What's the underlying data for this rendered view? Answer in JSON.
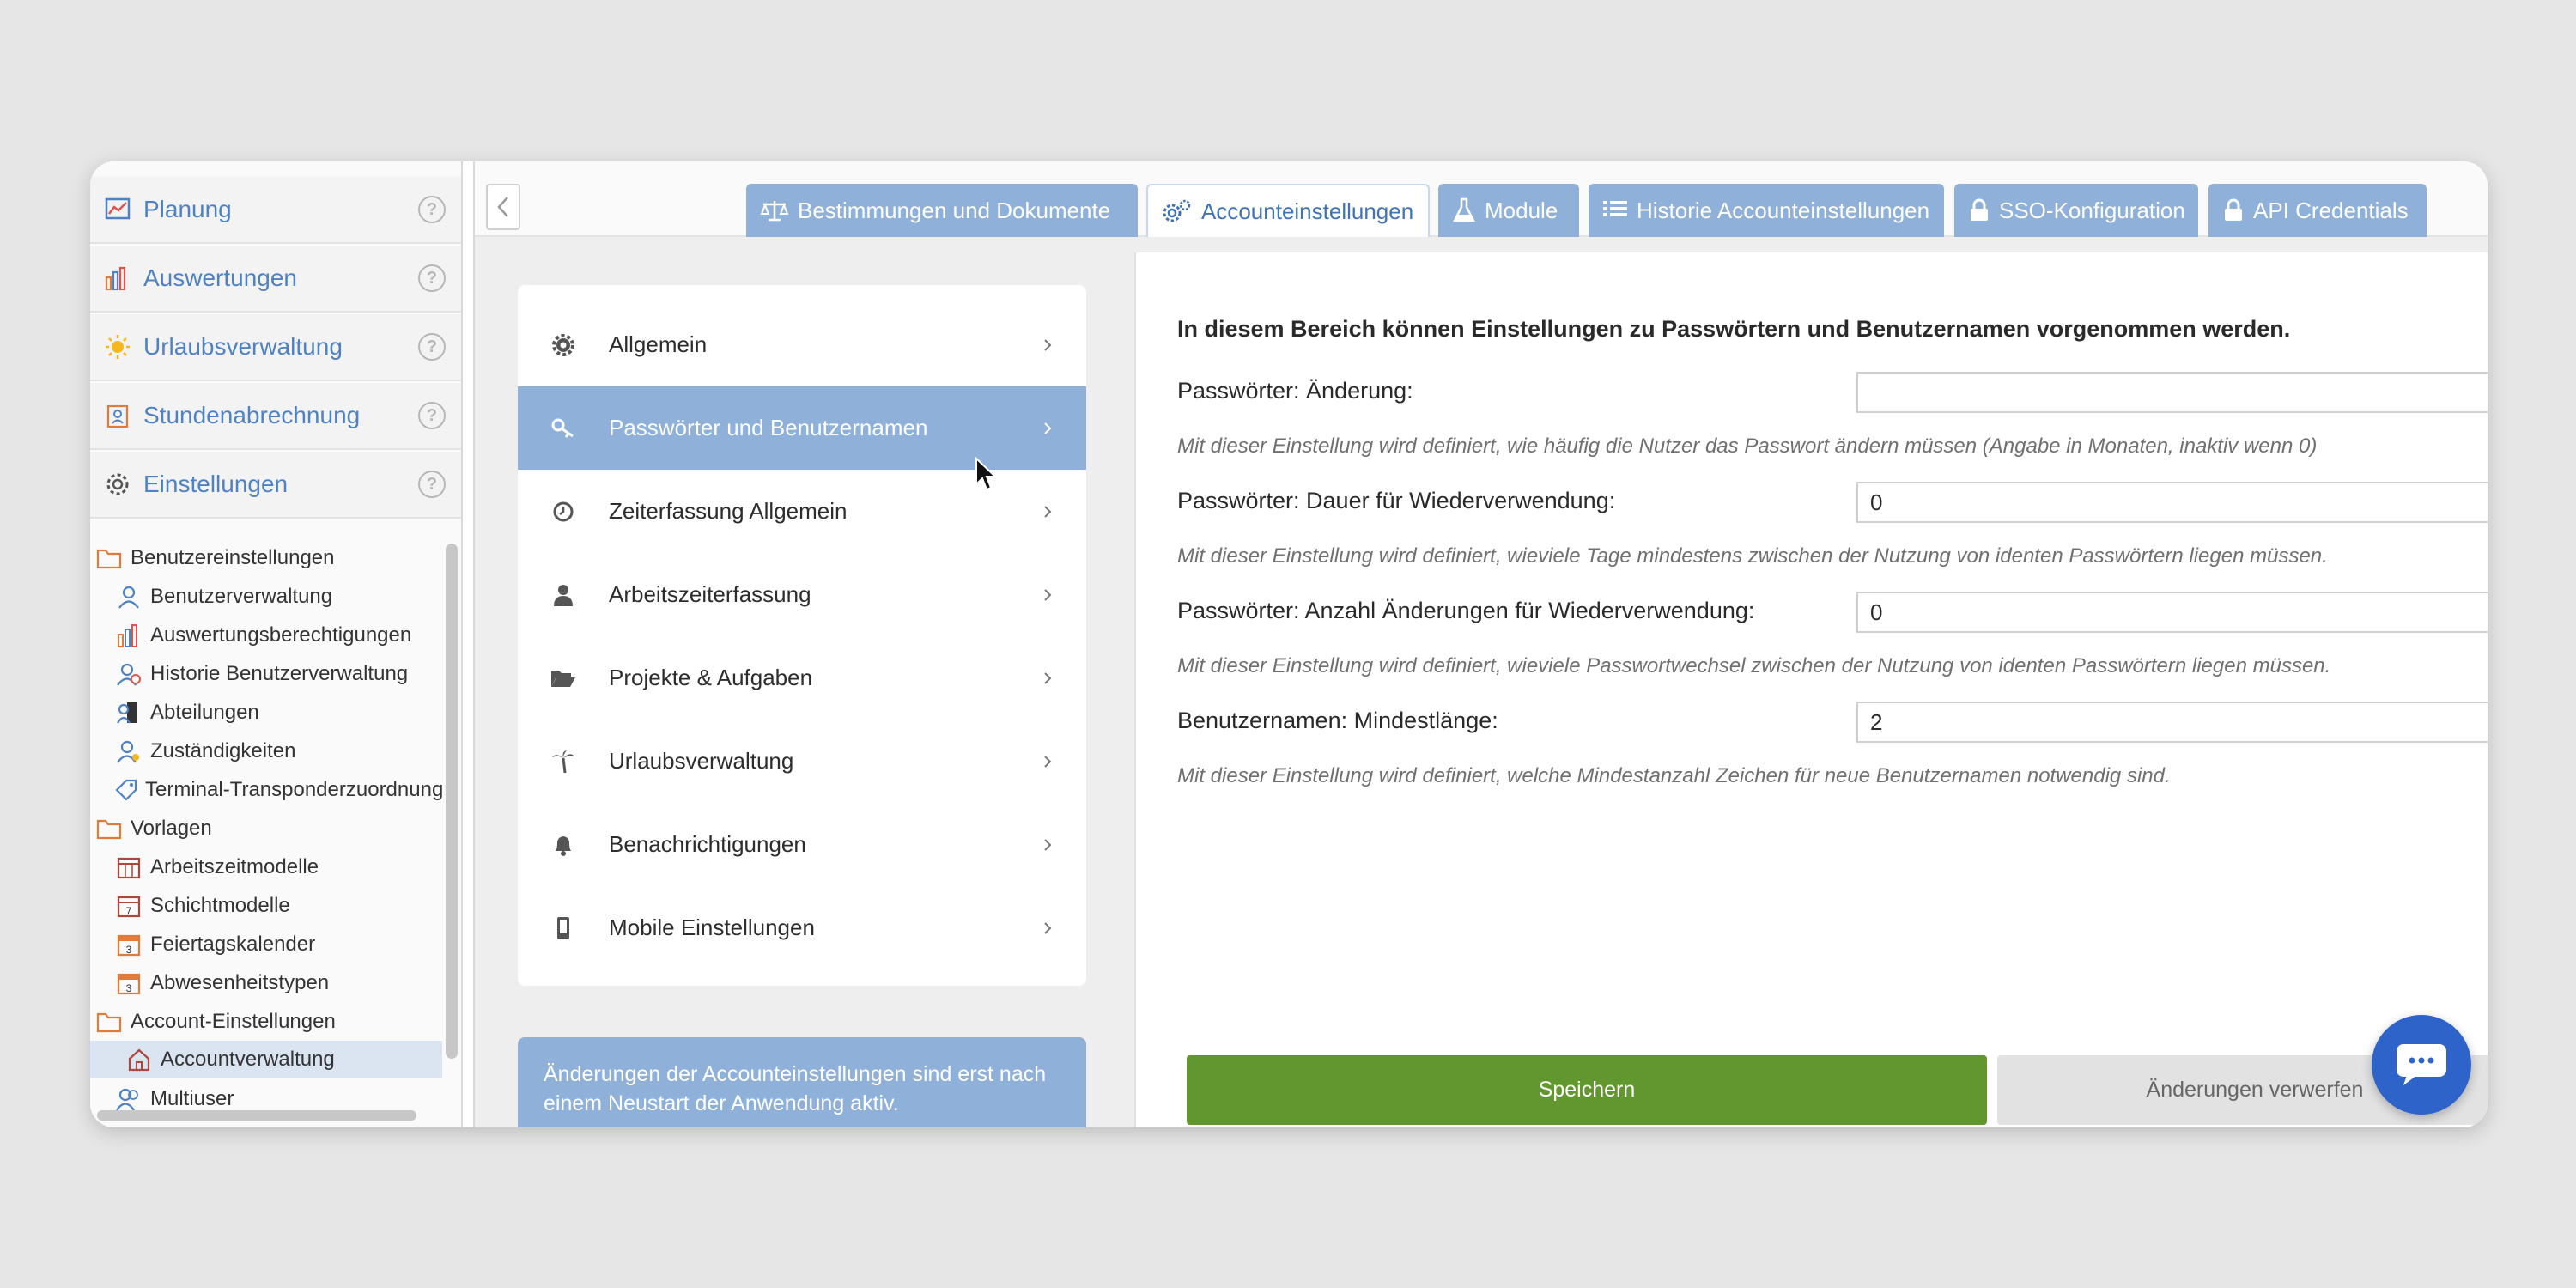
{
  "sidebar": {
    "nav": [
      {
        "label": "Planung",
        "icon": "chart-line-icon"
      },
      {
        "label": "Auswertungen",
        "icon": "bar-chart-icon"
      },
      {
        "label": "Urlaubsverwaltung",
        "icon": "sun-icon"
      },
      {
        "label": "Stundenabrechnung",
        "icon": "badge-icon"
      },
      {
        "label": "Einstellungen",
        "icon": "gear-icon"
      }
    ],
    "help_glyph": "?",
    "tree": [
      {
        "label": "Benutzereinstellungen",
        "type": "folder"
      },
      {
        "label": "Benutzerverwaltung",
        "type": "child"
      },
      {
        "label": "Auswertungsberechtigungen",
        "type": "child"
      },
      {
        "label": "Historie Benutzerverwaltung",
        "type": "child"
      },
      {
        "label": "Abteilungen",
        "type": "child"
      },
      {
        "label": "Zuständigkeiten",
        "type": "child"
      },
      {
        "label": "Terminal-Transponderzuordnung",
        "type": "child"
      },
      {
        "label": "Vorlagen",
        "type": "folder"
      },
      {
        "label": "Arbeitszeitmodelle",
        "type": "child"
      },
      {
        "label": "Schichtmodelle",
        "type": "child"
      },
      {
        "label": "Feiertagskalender",
        "type": "child"
      },
      {
        "label": "Abwesenheitstypen",
        "type": "child"
      },
      {
        "label": "Account-Einstellungen",
        "type": "folder"
      },
      {
        "label": "Accountverwaltung",
        "type": "child",
        "selected": true
      },
      {
        "label": "Multiuser",
        "type": "child"
      }
    ]
  },
  "tabs": [
    {
      "label": "Bestimmungen und Dokumente",
      "icon": "scale-icon",
      "active": false
    },
    {
      "label": "Accounteinstellungen",
      "icon": "gears-icon",
      "active": true
    },
    {
      "label": "Module",
      "icon": "flask-icon",
      "active": false
    },
    {
      "label": "Historie Accounteinstellungen",
      "icon": "list-icon",
      "active": false
    },
    {
      "label": "SSO-Konfiguration",
      "icon": "lock-icon",
      "active": false
    },
    {
      "label": "API Credentials",
      "icon": "lock-icon",
      "active": false
    }
  ],
  "menu": [
    {
      "label": "Allgemein",
      "icon": "gear-icon",
      "active": false
    },
    {
      "label": "Passwörter und Benutzernamen",
      "icon": "key-icon",
      "active": true
    },
    {
      "label": "Zeiterfassung Allgemein",
      "icon": "clock-icon",
      "active": false
    },
    {
      "label": "Arbeitszeiterfassung",
      "icon": "user-icon",
      "active": false
    },
    {
      "label": "Projekte & Aufgaben",
      "icon": "folder-open-icon",
      "active": false
    },
    {
      "label": "Urlaubsverwaltung",
      "icon": "palm-tree-icon",
      "active": false
    },
    {
      "label": "Benachrichtigungen",
      "icon": "bell-icon",
      "active": false
    },
    {
      "label": "Mobile Einstellungen",
      "icon": "mobile-icon",
      "active": false
    }
  ],
  "notice": "Änderungen der Accounteinstellungen sind erst nach einem Neustart der Anwendung aktiv.",
  "form": {
    "heading": "In diesem Bereich können Einstellungen zu Passwörtern und Benutzernamen vorgenommen werden.",
    "fields": [
      {
        "label": "Passwörter: Änderung:",
        "value": "",
        "hint": "Mit dieser Einstellung wird definiert, wie häufig die Nutzer das Passwort ändern müssen (Angabe in Monaten, inaktiv wenn 0)"
      },
      {
        "label": "Passwörter: Dauer für Wiederverwendung:",
        "value": "0",
        "hint": "Mit dieser Einstellung wird definiert, wieviele Tage mindestens zwischen der Nutzung von identen Passwörtern liegen müssen."
      },
      {
        "label": "Passwörter: Anzahl Änderungen für Wiederverwendung:",
        "value": "0",
        "hint": "Mit dieser Einstellung wird definiert, wieviele Passwortwechsel zwischen der Nutzung von identen Passwörtern liegen müssen."
      },
      {
        "label": "Benutzernamen: Mindestlänge:",
        "value": "2",
        "hint": "Mit dieser Einstellung wird definiert, welche Mindestanzahl Zeichen für neue Benutzernamen notwendig sind."
      }
    ]
  },
  "buttons": {
    "save": "Speichern",
    "discard": "Änderungen verwerfen"
  },
  "colors": {
    "accent": "#4e82c4",
    "tab_bg": "#8fb0d8",
    "save": "#62962f",
    "chat": "#2e63c9"
  }
}
